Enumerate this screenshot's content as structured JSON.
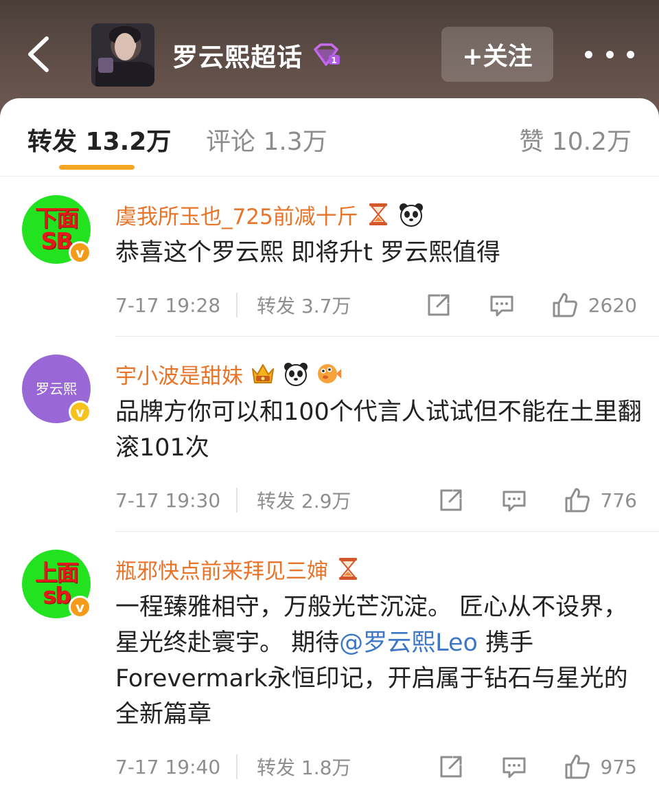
{
  "header": {
    "topic_title": "罗云熙超话",
    "follow_label": "+关注"
  },
  "tabs": [
    {
      "label": "转发 13.2万",
      "active": true
    },
    {
      "label": "评论 1.3万",
      "active": false
    },
    {
      "label": "赞 10.2万",
      "active": false
    }
  ],
  "colors": {
    "accent": "#f5a623",
    "username": "#e8742a",
    "mention": "#3d78c6"
  },
  "comments": [
    {
      "avatar_text": [
        "下面",
        "SB"
      ],
      "username": "虞我所玉也_725前减十斤",
      "badges": [
        "hourglass-icon",
        "panda-icon"
      ],
      "text": "恭喜这个罗云熙 即将升t 罗云熙值得",
      "time": "7-17 19:28",
      "reposts": "转发 3.7万",
      "likes": "2620"
    },
    {
      "avatar_text": [
        "罗云熙"
      ],
      "username": "宇小波是甜妹",
      "badges": [
        "crown-icon",
        "panda-icon",
        "pufferfish-icon"
      ],
      "text": "品牌方你可以和100个代言人试试但不能在土里翻滚101次",
      "time": "7-17 19:30",
      "reposts": "转发 2.9万",
      "likes": "776"
    },
    {
      "avatar_text": [
        "上面",
        "sb"
      ],
      "username": "瓶邪快点前来拜见三婶",
      "badges": [
        "hourglass-icon"
      ],
      "text_before": "一程臻雅相守，万般光芒沉淀。 匠心从不设界，星光终赴寰宇。 期待",
      "mention": "@罗云熙Leo",
      "text_after": " 携手Forevermark永恒印记，开启属于钻石与星光的全新篇章",
      "time": "7-17 19:40",
      "reposts": "转发 1.8万",
      "likes": "975"
    }
  ]
}
